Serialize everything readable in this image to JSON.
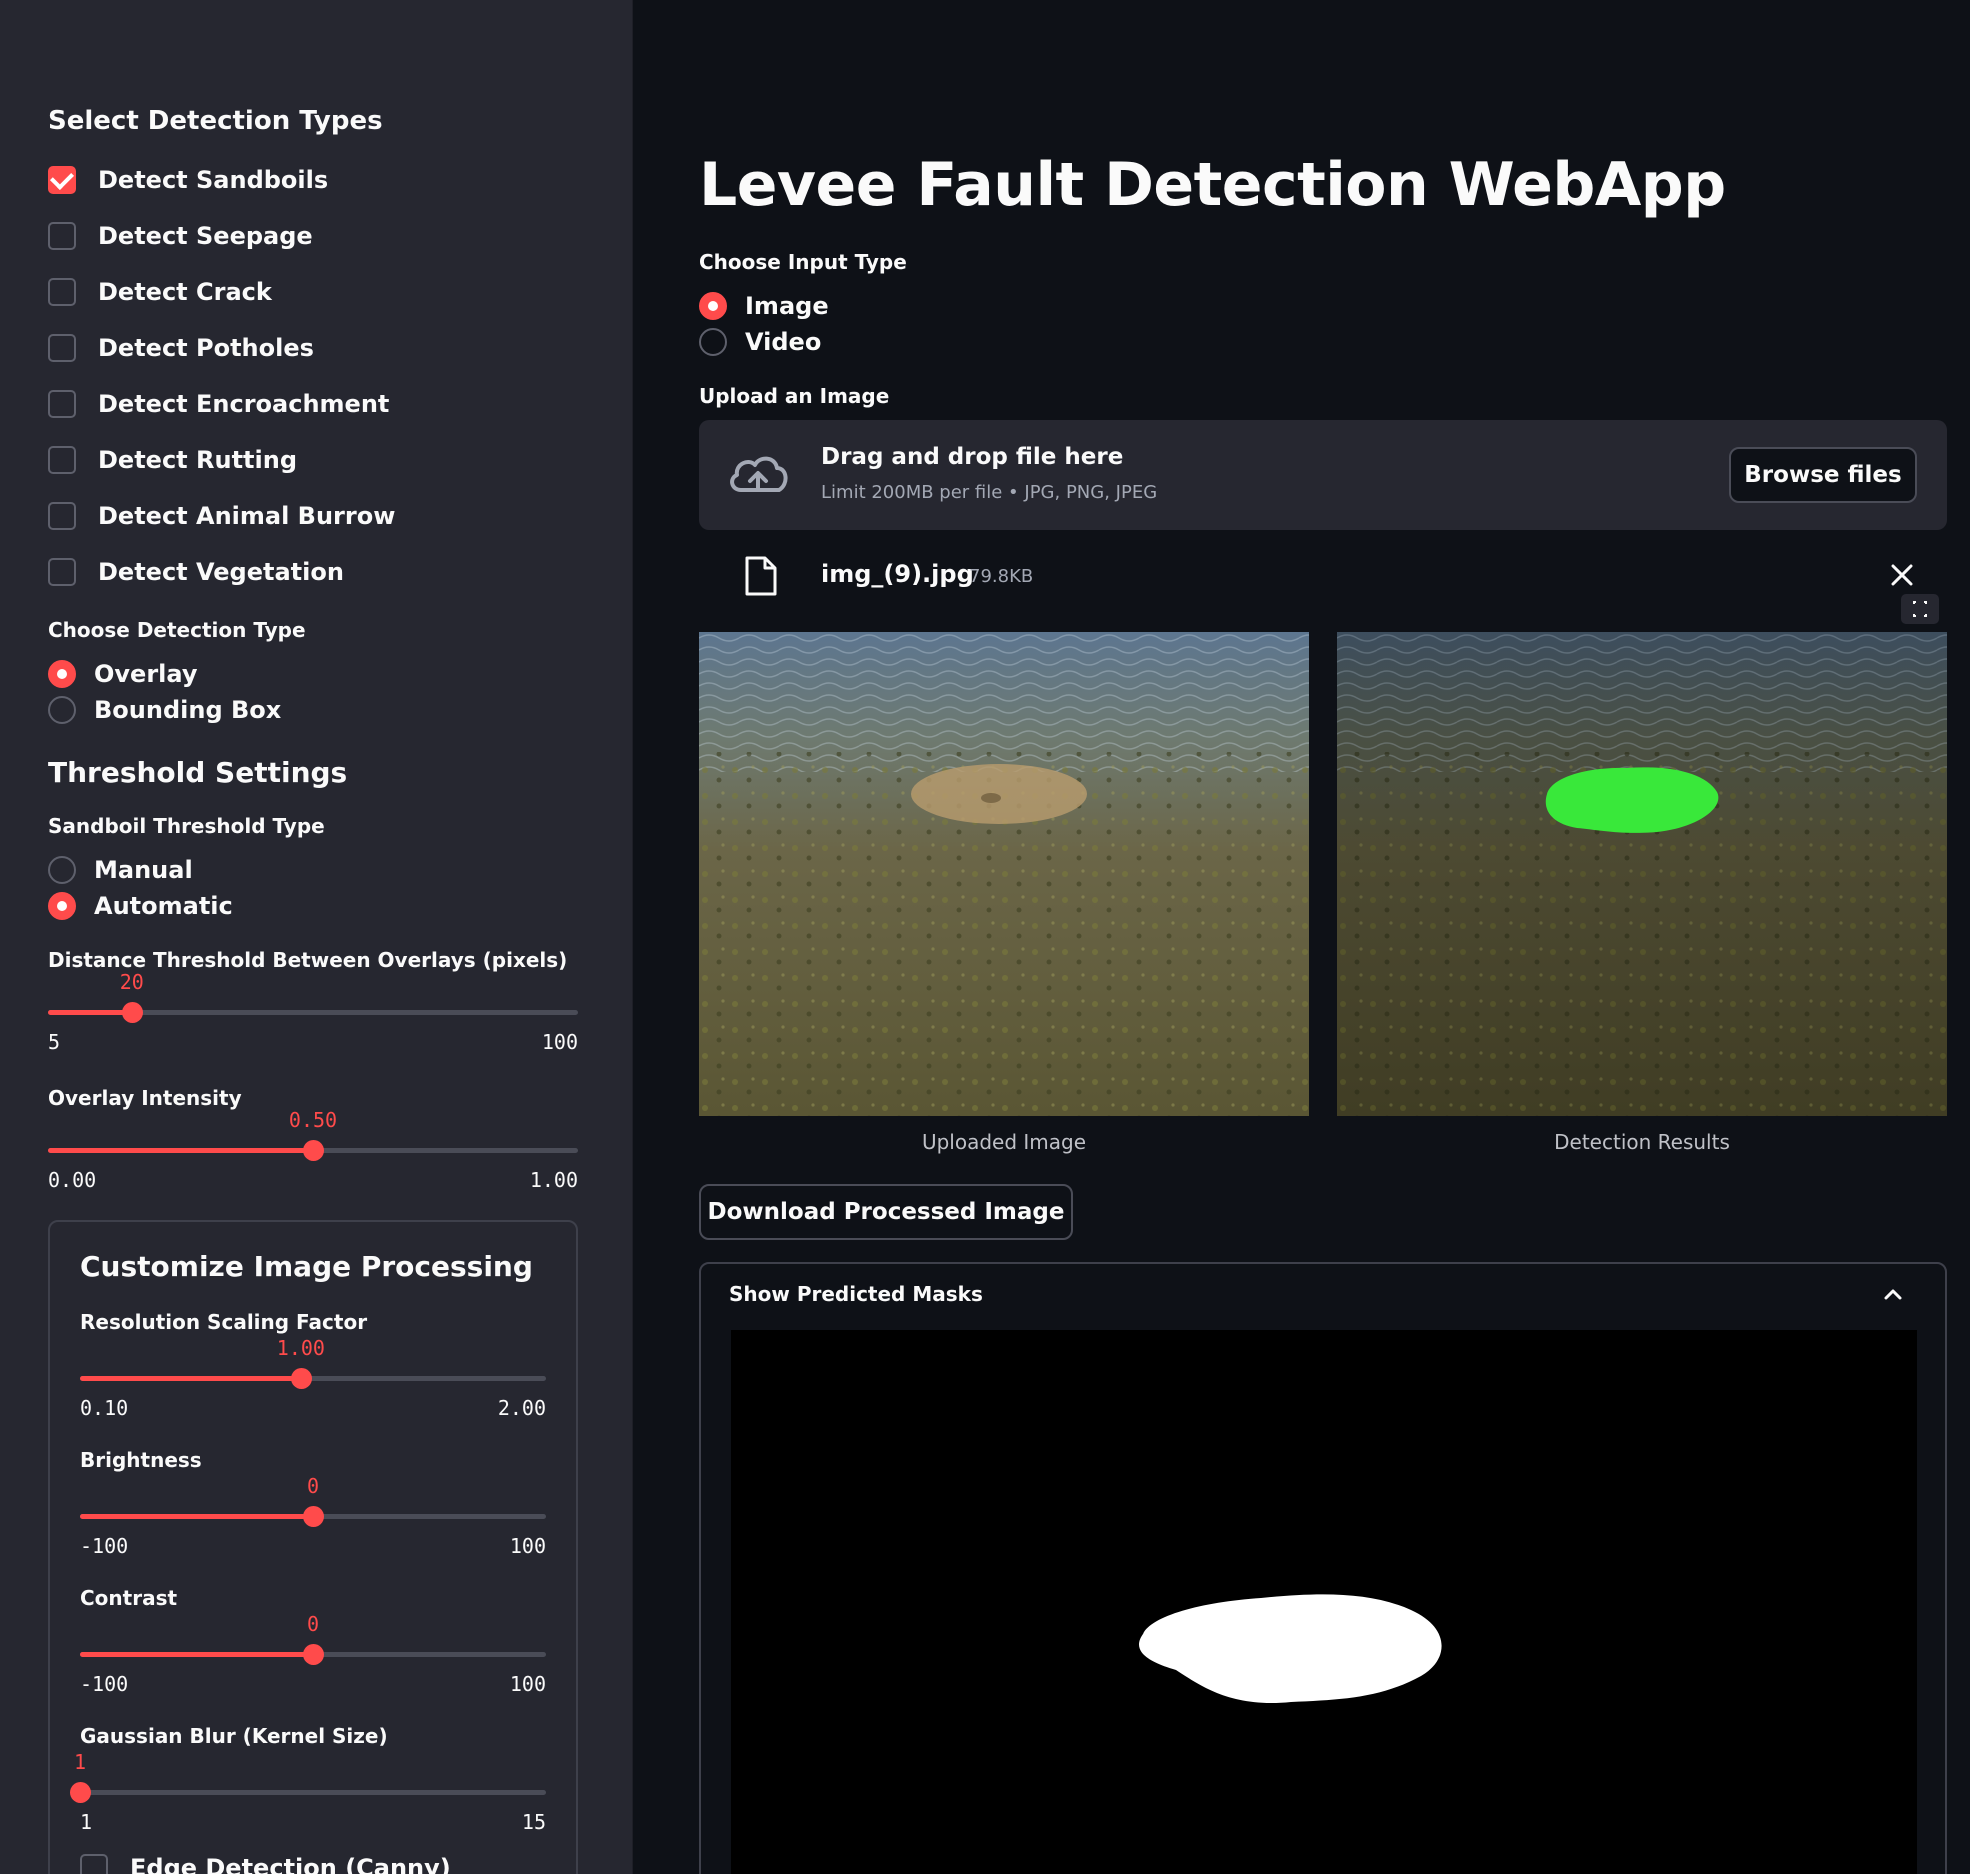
{
  "sidebar": {
    "select_heading": "Select Detection Types",
    "detections": [
      {
        "label": "Detect Sandboils",
        "checked": true
      },
      {
        "label": "Detect Seepage",
        "checked": false
      },
      {
        "label": "Detect Crack",
        "checked": false
      },
      {
        "label": "Detect Potholes",
        "checked": false
      },
      {
        "label": "Detect Encroachment",
        "checked": false
      },
      {
        "label": "Detect Rutting",
        "checked": false
      },
      {
        "label": "Detect Animal Burrow",
        "checked": false
      },
      {
        "label": "Detect Vegetation",
        "checked": false
      }
    ],
    "detection_type_label": "Choose Detection Type",
    "detection_type_options": [
      {
        "label": "Overlay",
        "selected": true
      },
      {
        "label": "Bounding Box",
        "selected": false
      }
    ],
    "threshold_heading": "Threshold Settings",
    "threshold_type_label": "Sandboil Threshold Type",
    "threshold_type_options": [
      {
        "label": "Manual",
        "selected": false
      },
      {
        "label": "Automatic",
        "selected": true
      }
    ],
    "sliders": {
      "distance": {
        "label": "Distance Threshold Between Overlays (pixels)",
        "value": "20",
        "min": "5",
        "max": "100",
        "fraction": 0.158
      },
      "intensity": {
        "label": "Overlay Intensity",
        "value": "0.50",
        "min": "0.00",
        "max": "1.00",
        "fraction": 0.5
      }
    },
    "custom": {
      "heading": "Customize Image Processing",
      "resolution": {
        "label": "Resolution Scaling Factor",
        "value": "1.00",
        "min": "0.10",
        "max": "2.00",
        "fraction": 0.474
      },
      "brightness": {
        "label": "Brightness",
        "value": "0",
        "min": "-100",
        "max": "100",
        "fraction": 0.5
      },
      "contrast": {
        "label": "Contrast",
        "value": "0",
        "min": "-100",
        "max": "100",
        "fraction": 0.5
      },
      "blur": {
        "label": "Gaussian Blur (Kernel Size)",
        "value": "1",
        "min": "1",
        "max": "15",
        "fraction": 0.0
      },
      "edge_label": "Edge Detection (Canny)"
    }
  },
  "main": {
    "title": "Levee Fault Detection WebApp",
    "input_type_label": "Choose Input Type",
    "input_options": [
      {
        "label": "Image",
        "selected": true
      },
      {
        "label": "Video",
        "selected": false
      }
    ],
    "upload_label": "Upload an Image",
    "uploader": {
      "drag_text": "Drag and drop file here",
      "limit_text": "Limit 200MB per file • JPG, PNG, JPEG",
      "browse_label": "Browse files"
    },
    "file": {
      "name": "img_(9).jpg",
      "size": "79.8KB"
    },
    "captions": {
      "uploaded": "Uploaded Image",
      "results": "Detection Results"
    },
    "download_label": "Download Processed Image",
    "expander_label": "Show Predicted Masks"
  },
  "colors": {
    "accent": "#ff4b4b",
    "sidebar_bg": "#262730",
    "main_bg": "#0e1117",
    "mask_green": "#39e83a"
  }
}
